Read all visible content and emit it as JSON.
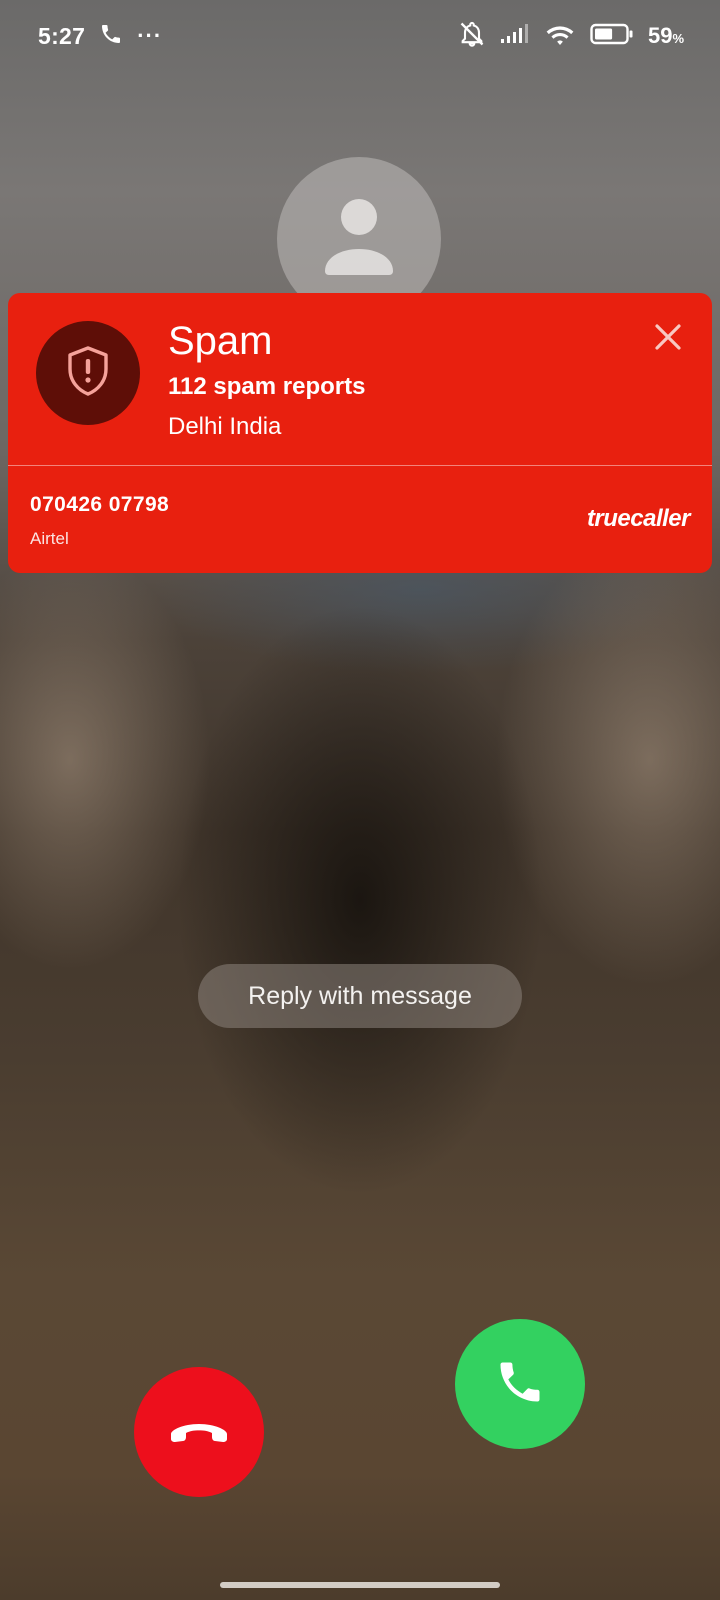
{
  "status_bar": {
    "time": "5:27",
    "more_indicator": "···",
    "battery_percent": "59",
    "battery_unit": "%",
    "battery_level": 0.59,
    "icons": [
      "call-icon",
      "mute-bell-icon",
      "signal-icon",
      "wifi-icon",
      "battery-icon"
    ]
  },
  "caller": {
    "avatar_icon": "person-icon"
  },
  "spam_card": {
    "title": "Spam",
    "reports": "112 spam reports",
    "location": "Delhi India",
    "number": "070426 07798",
    "carrier": "Airtel",
    "brand": "truecaller",
    "close_icon": "close-icon",
    "shield_icon": "shield-alert-icon",
    "color": "#e8200f"
  },
  "actions": {
    "reply_label": "Reply with message",
    "decline_icon": "hang-up-icon",
    "accept_icon": "phone-icon",
    "decline_color": "#ed0f1c",
    "accept_color": "#33d160"
  }
}
